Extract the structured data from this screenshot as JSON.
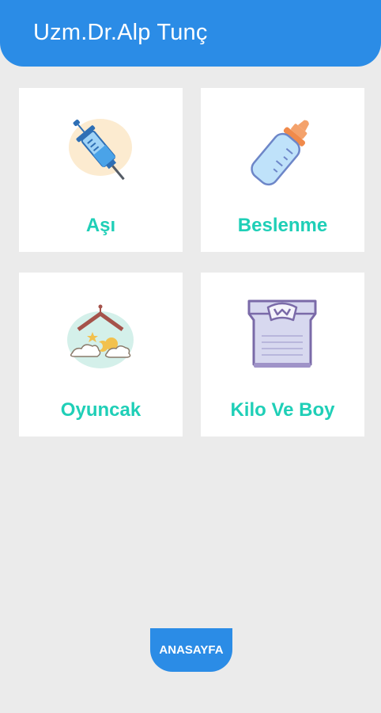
{
  "app_bar": {
    "title": "Uzm.Dr.Alp Tunç"
  },
  "menu": {
    "items": [
      {
        "label": "Aşı",
        "icon": "syringe-icon"
      },
      {
        "label": "Beslenme",
        "icon": "baby-bottle-icon"
      },
      {
        "label": "Oyuncak",
        "icon": "toy-house-icon"
      },
      {
        "label": "Kilo Ve Boy",
        "icon": "scale-icon"
      }
    ]
  },
  "bottom_nav": {
    "home_label": "ANASAYFA"
  },
  "colors": {
    "primary": "#2b8ce6",
    "accent_text": "#1fcfb7",
    "background": "#ebebeb",
    "card": "#ffffff"
  }
}
